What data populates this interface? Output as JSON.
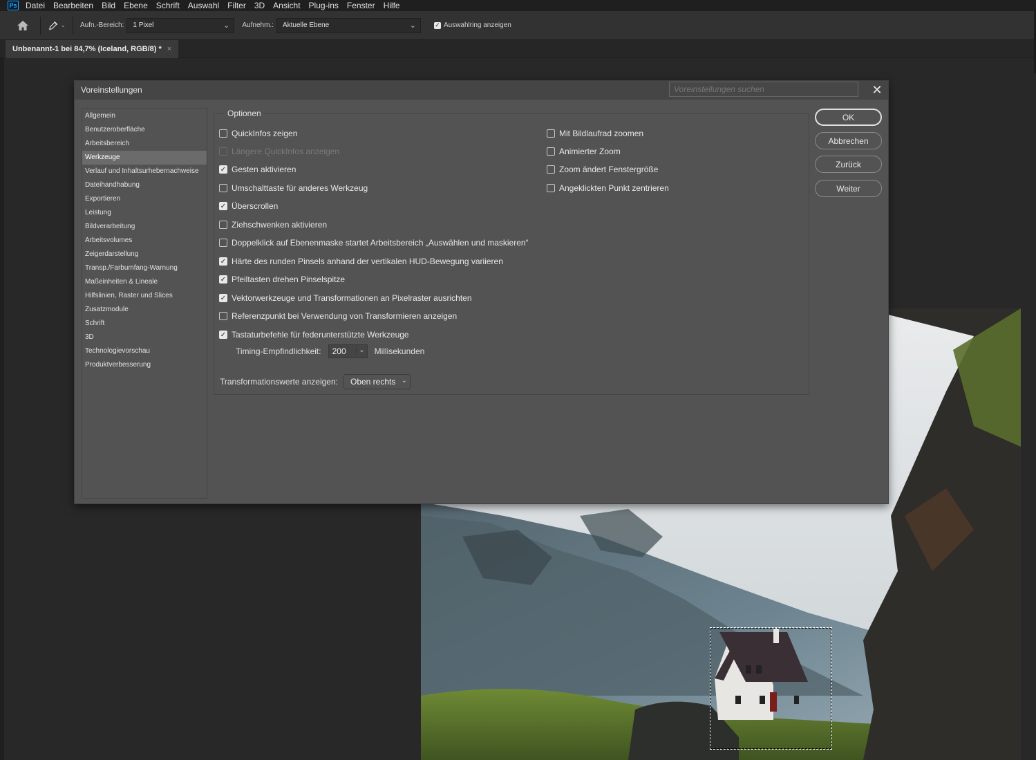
{
  "app": {
    "logo": "Ps"
  },
  "menu": [
    "Datei",
    "Bearbeiten",
    "Bild",
    "Ebene",
    "Schrift",
    "Auswahl",
    "Filter",
    "3D",
    "Ansicht",
    "Plug-ins",
    "Fenster",
    "Hilfe"
  ],
  "options_bar": {
    "sample_size_label": "Aufn.-Bereich:",
    "sample_size_value": "1 Pixel",
    "sample_label": "Aufnehm.:",
    "sample_value": "Aktuelle Ebene",
    "show_ring_label": "Auswahlring anzeigen",
    "show_ring_checked": true
  },
  "document_tab": {
    "title": "Unbenannt-1 bei 84,7% (Iceland, RGB/8) *",
    "close": "×"
  },
  "dialog": {
    "title": "Voreinstellungen",
    "search_placeholder": "Voreinstellungen suchen",
    "close": "✕",
    "nav": [
      "Allgemein",
      "Benutzeroberfläche",
      "Arbeitsbereich",
      "Werkzeuge",
      "Verlauf und Inhaltsurhebernachweise",
      "Dateihandhabung",
      "Exportieren",
      "Leistung",
      "Bildverarbeitung",
      "Arbeitsvolumes",
      "Zeigerdarstellung",
      "Transp./Farbumfang-Warnung",
      "Maßeinheiten & Lineale",
      "Hilfslinien, Raster und Slices",
      "Zusatzmodule",
      "Schrift",
      "3D",
      "Technologievorschau",
      "Produktverbesserung"
    ],
    "active_nav": "Werkzeuge",
    "group_title": "Optionen",
    "left_options": [
      {
        "label": "QuickInfos zeigen",
        "checked": false,
        "disabled": false
      },
      {
        "label": "Längere QuickInfos anzeigen",
        "checked": false,
        "disabled": true
      },
      {
        "label": "Gesten aktivieren",
        "checked": true,
        "disabled": false
      },
      {
        "label": "Umschalttaste für anderes Werkzeug",
        "checked": false,
        "disabled": false
      },
      {
        "label": "Überscrollen",
        "checked": true,
        "disabled": false
      },
      {
        "label": "Ziehschwenken aktivieren",
        "checked": false,
        "disabled": false
      },
      {
        "label": "Doppelklick auf Ebenenmaske startet Arbeitsbereich „Auswählen und maskieren“",
        "checked": false,
        "disabled": false
      },
      {
        "label": "Härte des runden Pinsels anhand der vertikalen HUD-Bewegung variieren",
        "checked": true,
        "disabled": false
      },
      {
        "label": "Pfeiltasten drehen Pinselspitze",
        "checked": true,
        "disabled": false
      },
      {
        "label": "Vektorwerkzeuge und Transformationen an Pixelraster ausrichten",
        "checked": true,
        "disabled": false
      },
      {
        "label": "Referenzpunkt bei Verwendung von Transformieren anzeigen",
        "checked": false,
        "disabled": false
      },
      {
        "label": "Tastaturbefehle für federunterstützte Werkzeuge",
        "checked": true,
        "disabled": false
      }
    ],
    "right_options": [
      {
        "label": "Mit Bildlaufrad zoomen",
        "checked": false
      },
      {
        "label": "Animierter Zoom",
        "checked": false
      },
      {
        "label": "Zoom ändert Fenstergröße",
        "checked": false
      },
      {
        "label": "Angeklickten Punkt zentrieren",
        "checked": false
      }
    ],
    "timing": {
      "label": "Timing-Empfindlichkeit:",
      "value": "200",
      "unit": "Millisekunden"
    },
    "transform": {
      "label": "Transformationswerte anzeigen:",
      "value": "Oben rechts"
    },
    "buttons": {
      "ok": "OK",
      "cancel": "Abbrechen",
      "back": "Zurück",
      "next": "Weiter"
    }
  }
}
